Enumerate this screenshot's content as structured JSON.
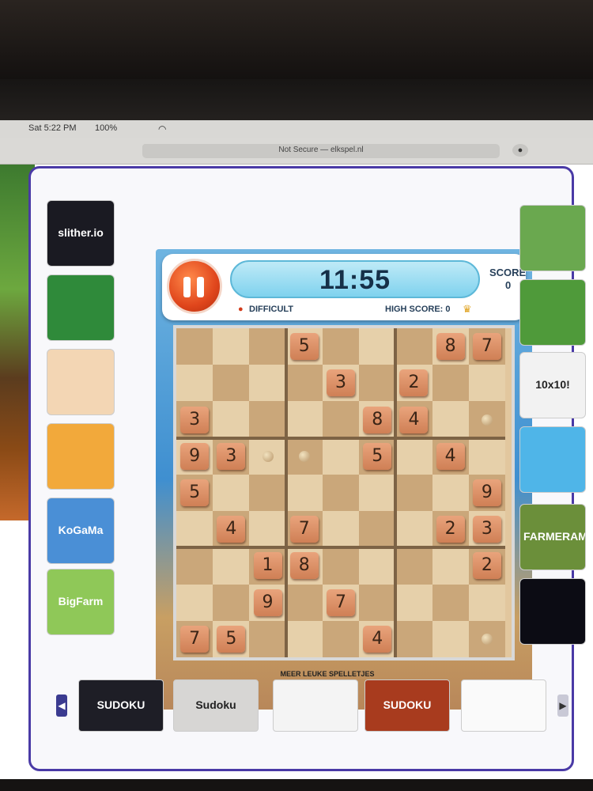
{
  "menubar": {
    "clock": "Sat 5:22 PM",
    "battery": "100%"
  },
  "browser": {
    "address": "Not Secure — elkspel.nl",
    "icons": [
      "reload-icon",
      "tabs-icon"
    ]
  },
  "game": {
    "timer": "11:55",
    "score_label": "SCORE",
    "score_value": "0",
    "high_score": "HIGH SCORE: 0",
    "difficulty": "DIFFICULT",
    "accent": "#e0461c",
    "timer_color": "#7fd2ee"
  },
  "sudoku": {
    "tiles": [
      {
        "r": 0,
        "c": 3,
        "v": "5"
      },
      {
        "r": 0,
        "c": 7,
        "v": "8"
      },
      {
        "r": 0,
        "c": 8,
        "v": "7"
      },
      {
        "r": 1,
        "c": 4,
        "v": "3"
      },
      {
        "r": 1,
        "c": 6,
        "v": "2"
      },
      {
        "r": 2,
        "c": 0,
        "v": "3"
      },
      {
        "r": 2,
        "c": 5,
        "v": "8"
      },
      {
        "r": 2,
        "c": 6,
        "v": "4"
      },
      {
        "r": 3,
        "c": 0,
        "v": "9"
      },
      {
        "r": 3,
        "c": 1,
        "v": "3"
      },
      {
        "r": 3,
        "c": 5,
        "v": "5"
      },
      {
        "r": 3,
        "c": 7,
        "v": "4"
      },
      {
        "r": 4,
        "c": 0,
        "v": "5"
      },
      {
        "r": 4,
        "c": 8,
        "v": "9"
      },
      {
        "r": 5,
        "c": 1,
        "v": "4"
      },
      {
        "r": 5,
        "c": 3,
        "v": "7"
      },
      {
        "r": 5,
        "c": 7,
        "v": "2"
      },
      {
        "r": 5,
        "c": 8,
        "v": "3"
      },
      {
        "r": 6,
        "c": 2,
        "v": "1"
      },
      {
        "r": 6,
        "c": 3,
        "v": "8"
      },
      {
        "r": 6,
        "c": 8,
        "v": "2"
      },
      {
        "r": 7,
        "c": 2,
        "v": "9"
      },
      {
        "r": 7,
        "c": 4,
        "v": "7"
      },
      {
        "r": 8,
        "c": 0,
        "v": "7"
      },
      {
        "r": 8,
        "c": 1,
        "v": "5"
      },
      {
        "r": 8,
        "c": 5,
        "v": "4"
      }
    ]
  },
  "left_games": [
    {
      "name": "slitherio",
      "label": "slither.io",
      "bg": "#1a1a22"
    },
    {
      "name": "solitaire",
      "label": "",
      "bg": "#2f8a3a"
    },
    {
      "name": "baby-hazel",
      "label": "",
      "bg": "#f3d6b4"
    },
    {
      "name": "cartoon-cat",
      "label": "",
      "bg": "#f2a93b"
    },
    {
      "name": "kogama",
      "label": "KoGaMa",
      "bg": "#4a8fd6"
    },
    {
      "name": "big-farm",
      "label": "BigFarm",
      "bg": "#8fc858"
    }
  ],
  "right_games": [
    {
      "name": "minecraft",
      "label": "",
      "bg": "#6aa84f"
    },
    {
      "name": "soccer",
      "label": "",
      "bg": "#4f9a3a"
    },
    {
      "name": "10x10",
      "label": "10x10!",
      "bg": "#f2f2f2"
    },
    {
      "name": "heart",
      "label": "",
      "bg": "#4fb5e8"
    },
    {
      "name": "farmerama",
      "label": "FARMERAMA",
      "bg": "#6b8f3a"
    },
    {
      "name": "dark-game",
      "label": "",
      "bg": "#0c0c14"
    }
  ],
  "more_games": {
    "label": "MEER LEUKE SPELLETJES",
    "items": [
      {
        "name": "sudoku-dark",
        "label": "SUDOKU",
        "bg": "#1e1e26"
      },
      {
        "name": "sudoku-black",
        "label": "Sudoku",
        "bg": "#d7d6d4"
      },
      {
        "name": "sudoku-grid",
        "label": "",
        "bg": "#f4f4f4"
      },
      {
        "name": "sudoku-classic",
        "label": "SUDOKU",
        "bg": "#a83b1e"
      },
      {
        "name": "sudoku-pencil",
        "label": "",
        "bg": "#fafafa"
      }
    ]
  }
}
